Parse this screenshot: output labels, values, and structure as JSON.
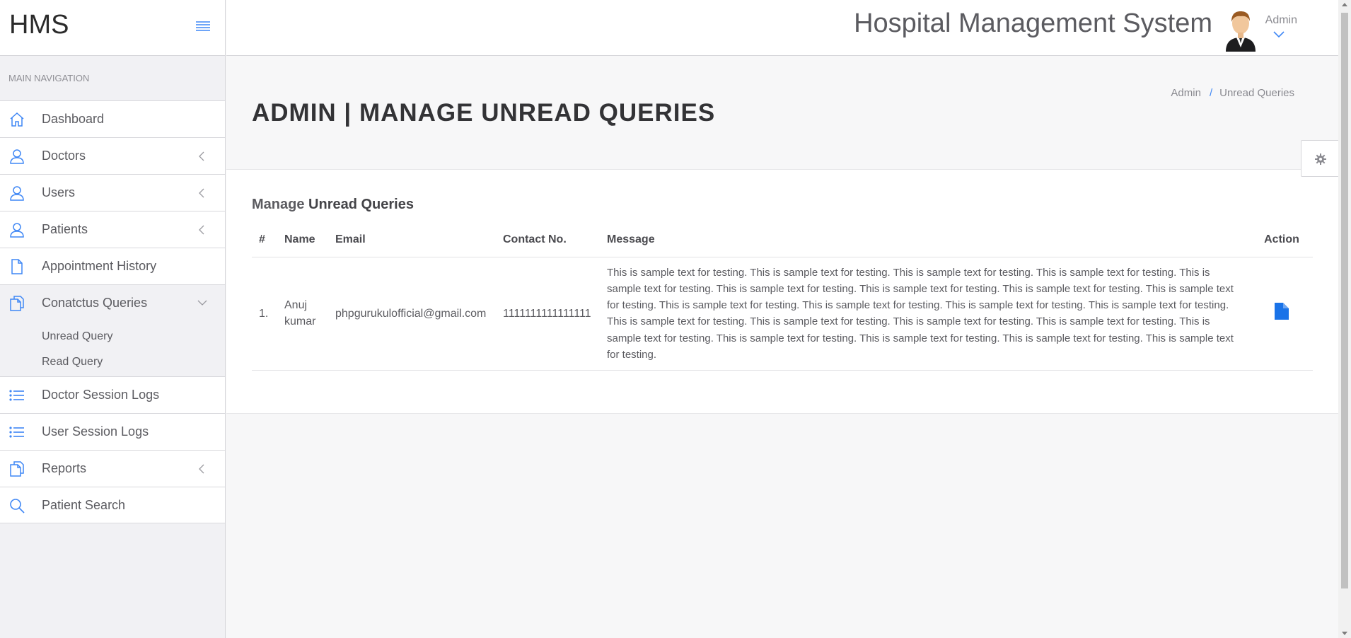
{
  "brand": {
    "logo": "HMS"
  },
  "topbar": {
    "system_title": "Hospital Management System",
    "user_name": "Admin"
  },
  "sidebar": {
    "caption": "MAIN NAVIGATION",
    "items": [
      {
        "label": "Dashboard",
        "icon": "home-icon"
      },
      {
        "label": "Doctors",
        "icon": "user-icon"
      },
      {
        "label": "Users",
        "icon": "user-icon"
      },
      {
        "label": "Patients",
        "icon": "user-icon"
      },
      {
        "label": "Appointment History",
        "icon": "file-icon"
      },
      {
        "label": "Conatctus Queries",
        "icon": "files-icon"
      },
      {
        "label": "Doctor Session Logs",
        "icon": "list-icon"
      },
      {
        "label": "User Session Logs",
        "icon": "list-icon"
      },
      {
        "label": "Reports",
        "icon": "files-icon"
      },
      {
        "label": "Patient Search",
        "icon": "search-icon"
      }
    ],
    "submenu": [
      {
        "label": "Unread Query"
      },
      {
        "label": "Read Query"
      }
    ]
  },
  "page": {
    "title": "ADMIN | MANAGE UNREAD QUERIES",
    "breadcrumb": {
      "root": "Admin",
      "separator": "/",
      "current": "Unread Queries"
    },
    "panel_title_prefix": "Manage",
    "panel_title_bold": "Unread Queries"
  },
  "table": {
    "headers": [
      "#",
      "Name",
      "Email",
      "Contact No.",
      "Message",
      "Action"
    ],
    "rows": [
      {
        "index": "1.",
        "name": "Anuj kumar",
        "email": "phpgurukulofficial@gmail.com",
        "contact": "1111111111111111",
        "message": "This is sample text for testing. This is sample text for testing. This is sample text for testing. This is sample text for testing. This is sample text for testing. This is sample text for testing. This is sample text for testing. This is sample text for testing. This is sample text for testing. This is sample text for testing. This is sample text for testing. This is sample text for testing. This is sample text for testing. This is sample text for testing. This is sample text for testing. This is sample text for testing. This is sample text for testing. This is sample text for testing. This is sample text for testing. This is sample text for testing. This is sample text for testing. This is sample text for testing.",
        "action_icon": "file-icon"
      }
    ]
  },
  "colors": {
    "accent": "#1a73e8",
    "icon_blue": "#3f87f5",
    "sidebar_bg": "#f1f1f4",
    "page_bg": "#f7f7f8"
  }
}
